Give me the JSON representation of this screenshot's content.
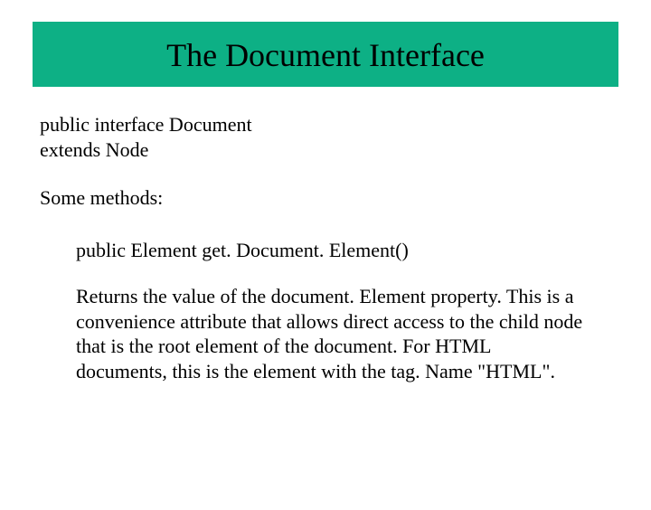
{
  "title": "The Document Interface",
  "declaration_line1": "public interface Document",
  "declaration_line2": "extends Node",
  "some_methods": "Some methods:",
  "method_signature": "public Element get. Document. Element()",
  "description": "Returns the value of the document. Element property. This  is a convenience attribute that allows direct access to the child node that is the root element of the document. For HTML documents, this is the element with the tag. Name \"HTML\"."
}
